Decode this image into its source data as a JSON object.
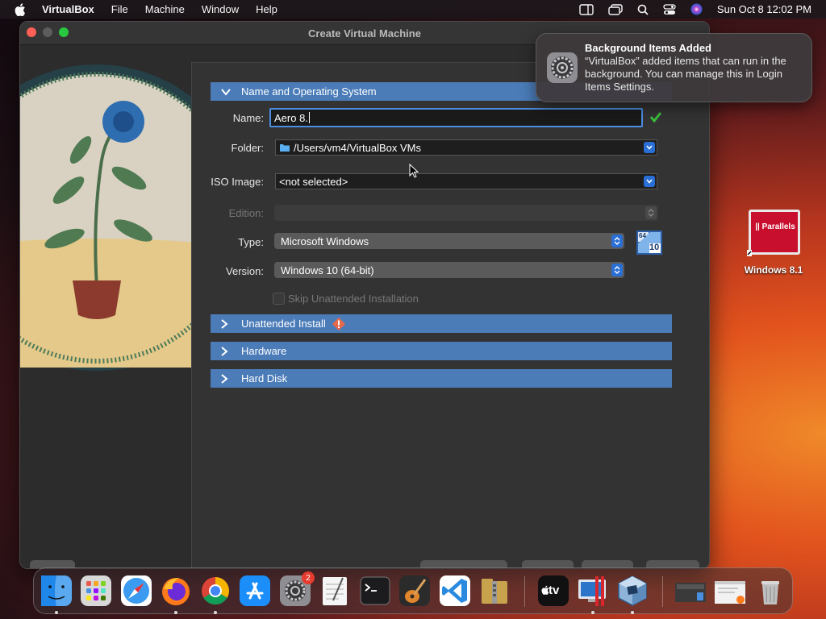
{
  "menubar": {
    "app_name": "VirtualBox",
    "items": [
      "File",
      "Machine",
      "Window",
      "Help"
    ],
    "clock": "Sun Oct 8  12:02 PM"
  },
  "window": {
    "title": "Create Virtual Machine",
    "sections": {
      "name_os": "Name and Operating System",
      "unattended": "Unattended Install",
      "hardware": "Hardware",
      "hard_disk": "Hard Disk"
    },
    "form": {
      "name_label": "Name:",
      "name_value": "Aero 8.",
      "folder_label": "Folder:",
      "folder_value": "/Users/vm4/VirtualBox VMs",
      "iso_label": "ISO Image:",
      "iso_value": "<not selected>",
      "edition_label": "Edition:",
      "edition_value": "",
      "type_label": "Type:",
      "type_value": "Microsoft Windows",
      "version_label": "Version:",
      "version_value": "Windows 10 (64-bit)",
      "os_badge_top": "64",
      "os_badge_bottom": "10",
      "skip_label": "Skip Unattended Installation"
    }
  },
  "notification": {
    "title": "Background Items Added",
    "body": "“VirtualBox” added items that can run in the background. You can manage this in Login Items Settings."
  },
  "desktop": {
    "icon_text": "|| Parallels",
    "label": "Windows 8.1"
  },
  "dock": {
    "settings_badge": "2",
    "appletv_text": "tv"
  },
  "colors": {
    "section_blue": "#4b7cb8",
    "accent_blue": "#2a6fd6",
    "valid_green": "#3bbf3b"
  }
}
